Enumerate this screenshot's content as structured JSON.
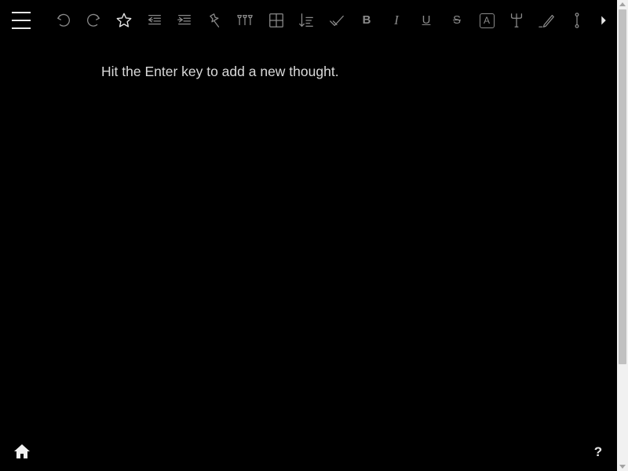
{
  "toolbar": {
    "tools": [
      {
        "name": "undo-icon"
      },
      {
        "name": "redo-icon"
      },
      {
        "name": "star-icon"
      },
      {
        "name": "outdent-icon"
      },
      {
        "name": "indent-icon"
      },
      {
        "name": "pin-icon"
      },
      {
        "name": "pin-all-icon"
      },
      {
        "name": "table-icon"
      },
      {
        "name": "sort-icon"
      },
      {
        "name": "checkmark-icon"
      },
      {
        "name": "bold-icon",
        "glyph": "B"
      },
      {
        "name": "italic-icon",
        "glyph": "I"
      },
      {
        "name": "underline-icon",
        "glyph": "U"
      },
      {
        "name": "strikethrough-icon",
        "glyph": "S"
      },
      {
        "name": "letter-case-icon",
        "glyph": "A"
      },
      {
        "name": "subcategorize-icon"
      },
      {
        "name": "pen-icon"
      },
      {
        "name": "split-icon"
      },
      {
        "name": "chevron-right-icon"
      }
    ]
  },
  "editor": {
    "hint": "Hit the Enter key to add a new thought."
  },
  "footer": {
    "help_label": "?"
  },
  "colors": {
    "background": "#000000",
    "icon": "#8a8a8a",
    "text": "#d9d9d9"
  }
}
